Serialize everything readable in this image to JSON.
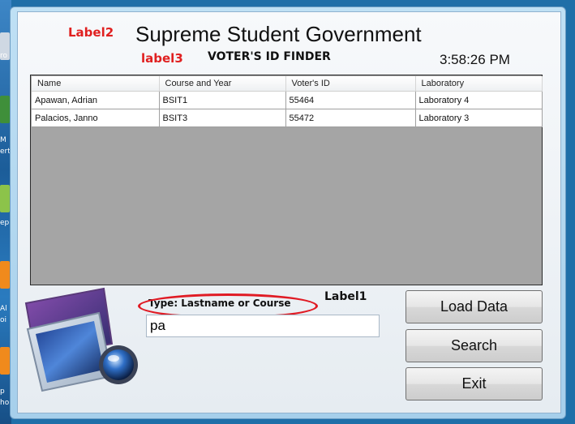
{
  "window": {
    "title": "Supreme Student Government",
    "label2": "Label2",
    "label3": "label3",
    "subtitle": "VOTER'S ID FINDER",
    "clock": "3:58:26 PM"
  },
  "grid": {
    "columns": [
      "Name",
      "Course and Year",
      "Voter's ID",
      "Laboratory"
    ],
    "rows": [
      [
        "Apawan, Adrian",
        "BSIT1",
        "55464",
        "Laboratory 4"
      ],
      [
        "Palacios, Janno",
        "BSIT3",
        "55472",
        "Laboratory 3"
      ]
    ]
  },
  "search": {
    "prompt": "Type: Lastname or Course",
    "value": "pa",
    "label1": "Label1"
  },
  "buttons": {
    "load": "Load Data",
    "search": "Search",
    "exit": "Exit"
  },
  "desktop": {
    "labels": [
      "ro",
      "M",
      "ert",
      "ep",
      "Al",
      "oi",
      "p",
      "ho"
    ]
  },
  "colors": {
    "annotation_red": "#e01b24",
    "grid_background": "#a5a5a5"
  },
  "icons": [
    "desktop-app-icon",
    "media-viewer-logo"
  ]
}
